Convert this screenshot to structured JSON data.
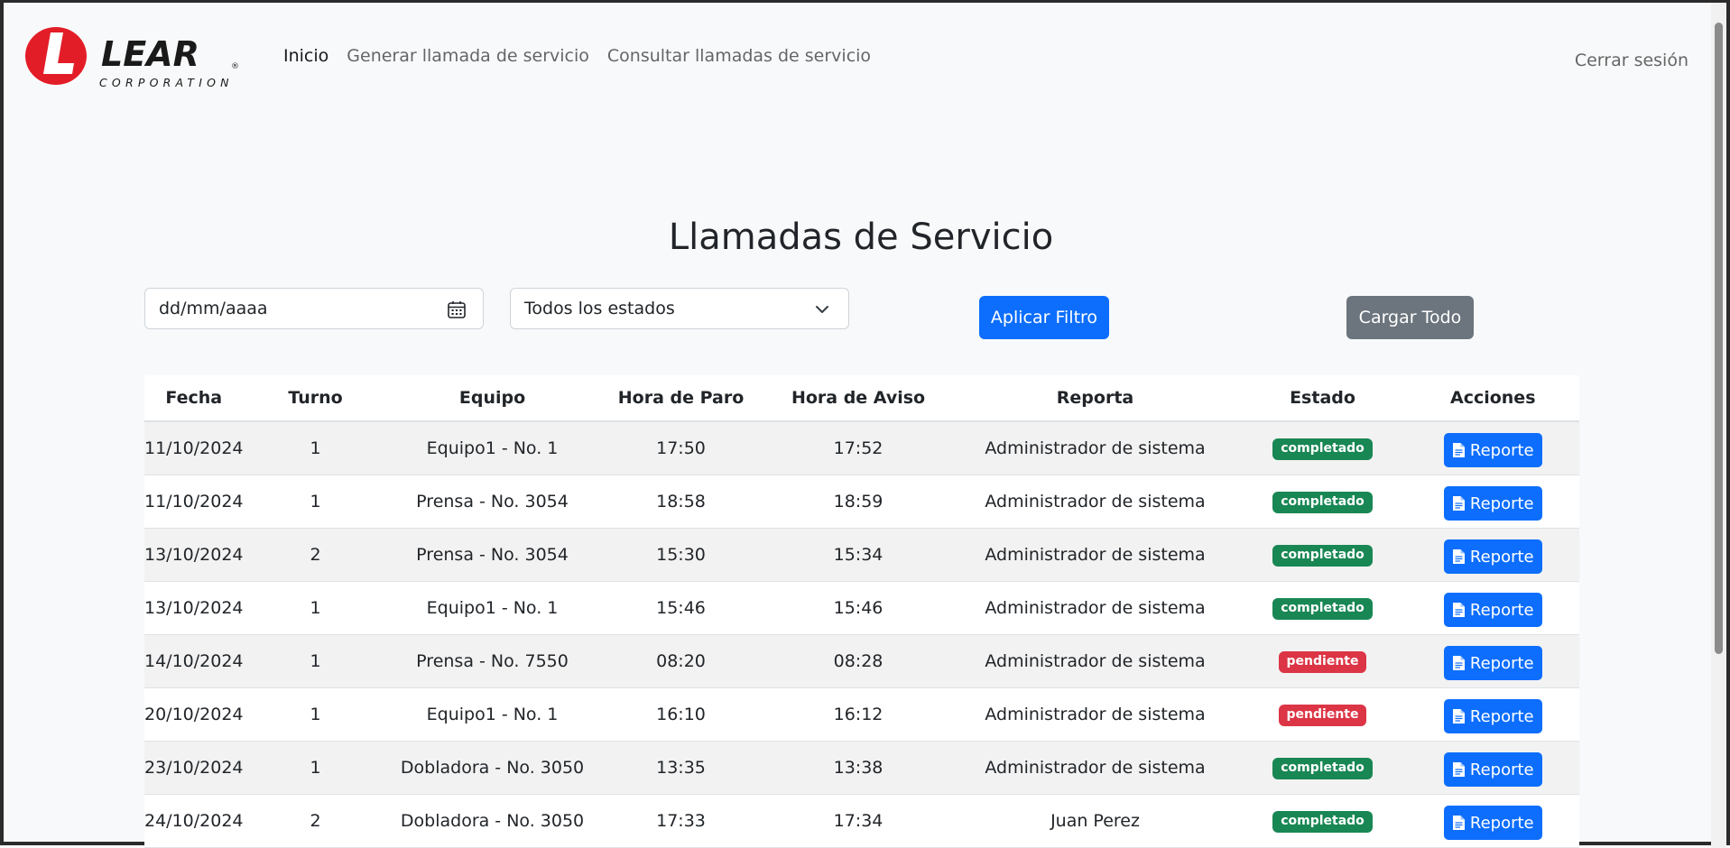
{
  "brand": {
    "name": "LEAR",
    "sub": "CORPORATION",
    "registered": "®"
  },
  "nav": {
    "items": [
      {
        "label": "Inicio",
        "active": true
      },
      {
        "label": "Generar llamada de servicio",
        "active": false
      },
      {
        "label": "Consultar llamadas de servicio",
        "active": false
      }
    ],
    "logout": "Cerrar sesión"
  },
  "page_title": "Llamadas de Servicio",
  "filters": {
    "date_placeholder": "dd/mm/aaaa",
    "status_selected": "Todos los estados",
    "apply_label": "Aplicar Filtro",
    "load_all_label": "Cargar Todo"
  },
  "table": {
    "headers": [
      "Fecha",
      "Turno",
      "Equipo",
      "Hora de Paro",
      "Hora de Aviso",
      "Reporta",
      "Estado",
      "Acciones"
    ],
    "action_label": "Reporte",
    "rows": [
      {
        "fecha": "11/10/2024",
        "turno": "1",
        "equipo": "Equipo1 - No. 1",
        "paro": "17:50",
        "aviso": "17:52",
        "reporta": "Administrador de sistema",
        "estado": "completado"
      },
      {
        "fecha": "11/10/2024",
        "turno": "1",
        "equipo": "Prensa - No. 3054",
        "paro": "18:58",
        "aviso": "18:59",
        "reporta": "Administrador de sistema",
        "estado": "completado"
      },
      {
        "fecha": "13/10/2024",
        "turno": "2",
        "equipo": "Prensa - No. 3054",
        "paro": "15:30",
        "aviso": "15:34",
        "reporta": "Administrador de sistema",
        "estado": "completado"
      },
      {
        "fecha": "13/10/2024",
        "turno": "1",
        "equipo": "Equipo1 - No. 1",
        "paro": "15:46",
        "aviso": "15:46",
        "reporta": "Administrador de sistema",
        "estado": "completado"
      },
      {
        "fecha": "14/10/2024",
        "turno": "1",
        "equipo": "Prensa - No. 7550",
        "paro": "08:20",
        "aviso": "08:28",
        "reporta": "Administrador de sistema",
        "estado": "pendiente"
      },
      {
        "fecha": "20/10/2024",
        "turno": "1",
        "equipo": "Equipo1 - No. 1",
        "paro": "16:10",
        "aviso": "16:12",
        "reporta": "Administrador de sistema",
        "estado": "pendiente"
      },
      {
        "fecha": "23/10/2024",
        "turno": "1",
        "equipo": "Dobladora - No. 3050",
        "paro": "13:35",
        "aviso": "13:38",
        "reporta": "Administrador de sistema",
        "estado": "completado"
      },
      {
        "fecha": "24/10/2024",
        "turno": "2",
        "equipo": "Dobladora - No. 3050",
        "paro": "17:33",
        "aviso": "17:34",
        "reporta": "Juan Perez",
        "estado": "completado"
      }
    ]
  },
  "colors": {
    "primary": "#0d6efd",
    "secondary": "#6c757d",
    "success": "#198754",
    "danger": "#dc3545",
    "brand_red": "#e31d27"
  }
}
